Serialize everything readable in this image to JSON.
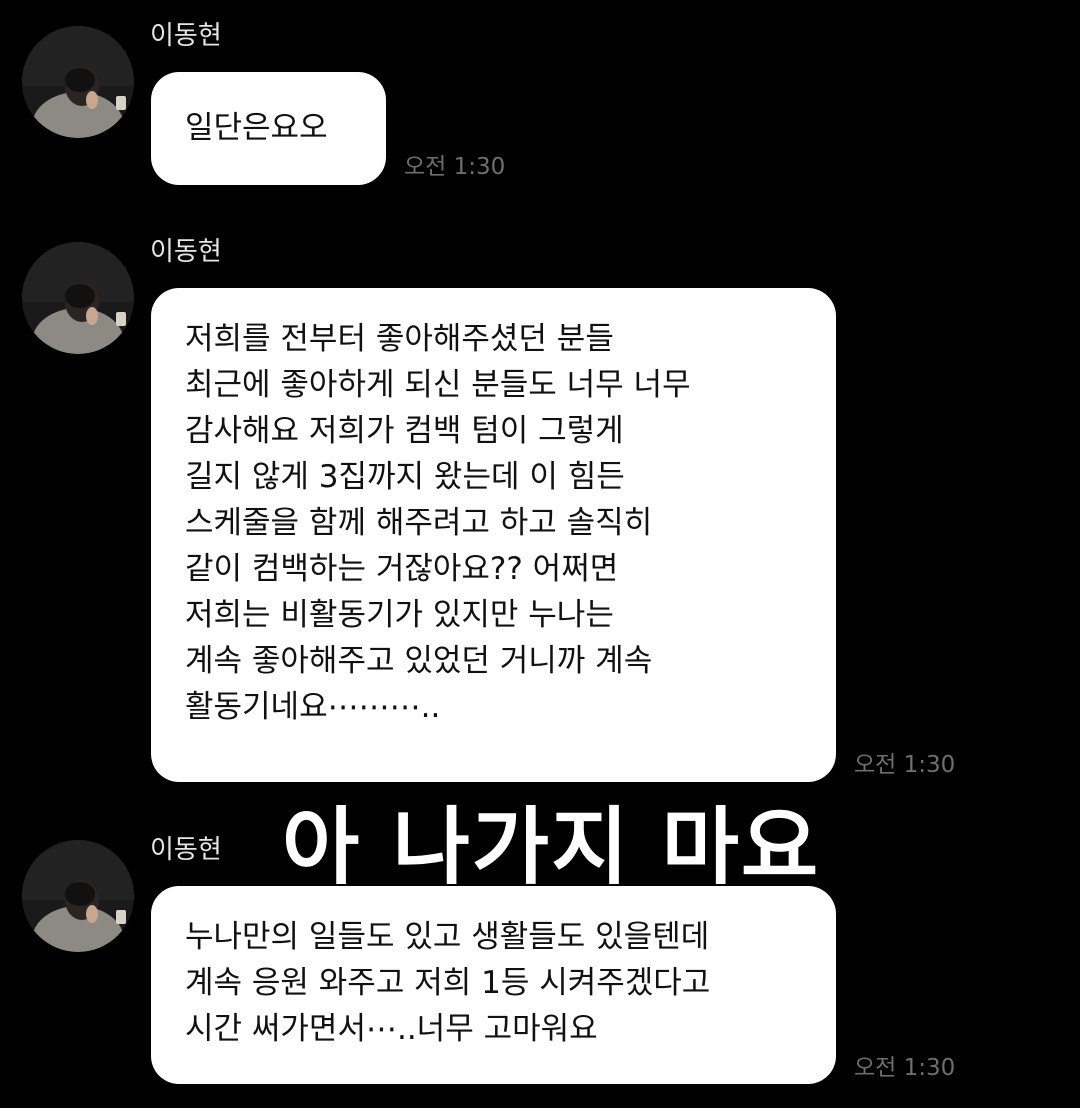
{
  "colors": {
    "background": "#000000",
    "bubble": "#ffffff",
    "bubble_text": "#111111",
    "name_text": "#e6e6e6",
    "timestamp_text": "#6e6e6e",
    "caption_text": "#ffffff"
  },
  "messages": [
    {
      "sender": "이동현",
      "avatar_icon": "profile-photo-avatar",
      "lines": [
        "일단은요오"
      ],
      "time": "오전 1:30"
    },
    {
      "sender": "이동현",
      "avatar_icon": "profile-photo-avatar",
      "lines": [
        "저희를 전부터 좋아해주셨던 분들",
        "최근에 좋아하게 되신 분들도 너무 너무",
        "감사해요 저희가 컴백 텀이 그렇게",
        "길지 않게 3집까지 왔는데 이 힘든",
        "스케줄을 함께 해주려고 하고 솔직히",
        "같이 컴백하는 거잖아요?? 어쩌면",
        "저희는 비활동기가 있지만 누나는",
        "계속 좋아해주고 있었던 거니까 계속",
        "활동기네요⋯⋯⋯.."
      ],
      "time": "오전 1:30"
    },
    {
      "sender": "이동현",
      "avatar_icon": "profile-photo-avatar",
      "lines": [
        "누나만의 일들도 있고 생활들도 있을텐데",
        "계속 응원 와주고 저희 1등 시켜주겠다고",
        "시간 써가면서⋯..너무 고마워요"
      ],
      "time": "오전 1:30"
    }
  ],
  "overlay_caption": "아 나가지 마요"
}
